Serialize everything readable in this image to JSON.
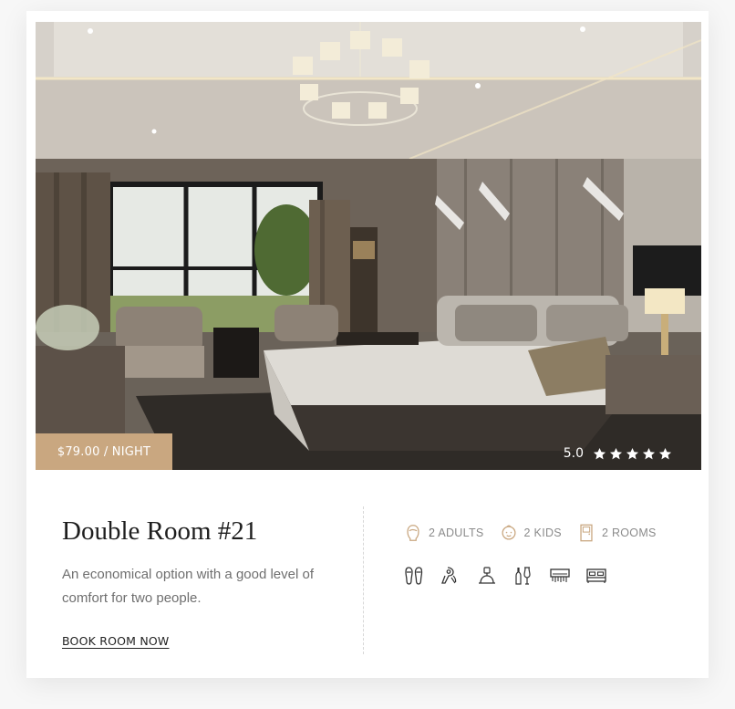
{
  "room": {
    "price": "$79.00 / NIGHT",
    "rating": "5.0",
    "rating_stars": 5,
    "title": "Double Room #21",
    "description": "An economical option with a good level of comfort for two people.",
    "cta": "BOOK ROOM NOW"
  },
  "capacity": [
    {
      "icon": "adult-icon",
      "label": "2 ADULTS"
    },
    {
      "icon": "kid-icon",
      "label": "2 KIDS"
    },
    {
      "icon": "door-icon",
      "label": "2 ROOMS"
    }
  ],
  "amenities": [
    {
      "icon": "slippers-icon"
    },
    {
      "icon": "hairdryer-icon"
    },
    {
      "icon": "room-service-icon"
    },
    {
      "icon": "minibar-icon"
    },
    {
      "icon": "air-conditioner-icon"
    },
    {
      "icon": "bed-icon"
    }
  ],
  "colors": {
    "accent": "#c9a780",
    "icon": "#c9a780",
    "title": "#1e1e1e",
    "text": "#6f6f6f"
  }
}
